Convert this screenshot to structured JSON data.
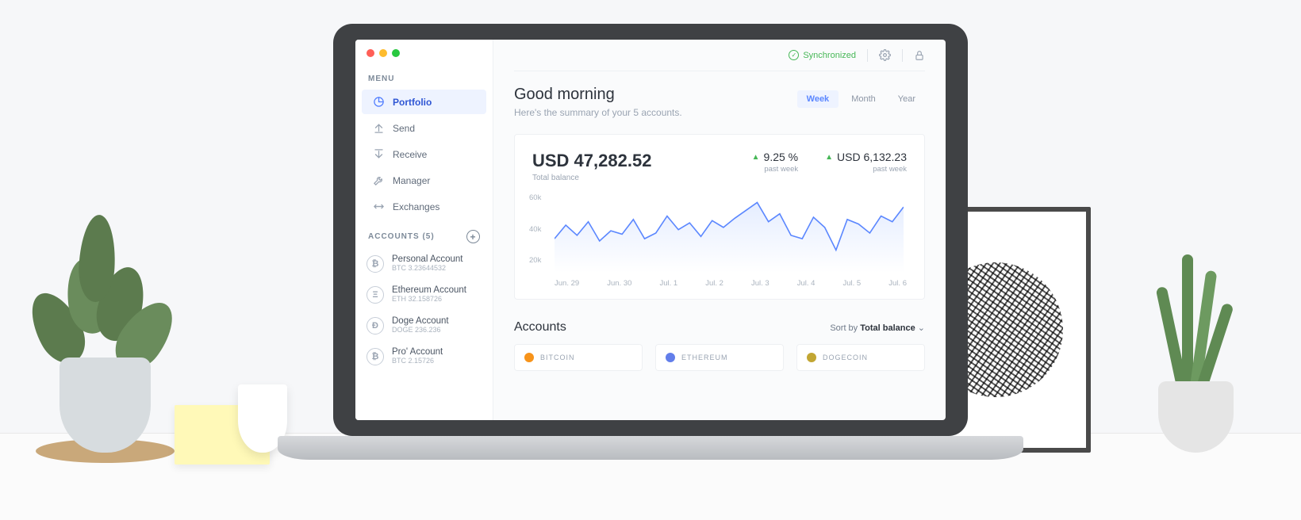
{
  "sidebar": {
    "menu_hdr": "MENU",
    "items": [
      {
        "label": "Portfolio",
        "icon": "pie-chart-icon",
        "active": true
      },
      {
        "label": "Send",
        "icon": "send-up-icon",
        "active": false
      },
      {
        "label": "Receive",
        "icon": "receive-down-icon",
        "active": false
      },
      {
        "label": "Manager",
        "icon": "wrench-icon",
        "active": false
      },
      {
        "label": "Exchanges",
        "icon": "swap-icon",
        "active": false
      }
    ],
    "accounts_hdr": "ACCOUNTS (5)",
    "accounts": [
      {
        "name": "Personal Account",
        "sub": "BTC 3.23644532",
        "sym": "₿"
      },
      {
        "name": "Ethereum Account",
        "sub": "ETH 32.158726",
        "sym": "Ξ"
      },
      {
        "name": "Doge Account",
        "sub": "DOGE 236.236",
        "sym": "Ð"
      },
      {
        "name": "Pro' Account",
        "sub": "BTC 2.15726",
        "sym": "₿"
      }
    ]
  },
  "header": {
    "sync": "Synchronized"
  },
  "greeting": {
    "title": "Good morning",
    "subtitle": "Here's the summary of your 5 accounts."
  },
  "range": {
    "week": "Week",
    "month": "Month",
    "year": "Year",
    "selected": "week"
  },
  "balance": {
    "total_label": "Total balance",
    "total": "USD 47,282.52",
    "change_pct": "9.25 %",
    "change_pct_label": "past week",
    "change_abs": "USD 6,132.23",
    "change_abs_label": "past week"
  },
  "chart_data": {
    "type": "line",
    "title": "Total balance past week",
    "xlabel": "",
    "ylabel": "",
    "ylim": [
      0,
      70000
    ],
    "y_ticks": [
      "60k",
      "40k",
      "20k"
    ],
    "x_ticks": [
      "Jun. 29",
      "Jun. 30",
      "Jul. 1",
      "Jul. 2",
      "Jul. 3",
      "Jul. 4",
      "Jul. 5",
      "Jul. 6"
    ],
    "x": [
      0,
      1,
      2,
      3,
      4,
      5,
      6,
      7,
      8,
      9,
      10,
      11,
      12,
      13,
      14,
      15,
      16,
      17,
      18,
      19,
      20,
      21,
      22,
      23,
      24,
      25,
      26,
      27,
      28,
      29,
      30,
      31
    ],
    "values": [
      30000,
      42000,
      33000,
      45000,
      28000,
      37000,
      34000,
      47000,
      30000,
      35000,
      50000,
      38000,
      44000,
      32000,
      46000,
      40000,
      48000,
      55000,
      62000,
      45000,
      52000,
      33000,
      30000,
      49000,
      40000,
      20000,
      47000,
      43000,
      35000,
      50000,
      45000,
      58000
    ]
  },
  "accounts_section": {
    "title": "Accounts",
    "sort_prefix": "Sort by ",
    "sort_value": "Total balance",
    "cards": [
      {
        "coin": "BITCOIN",
        "color": "#f7931a"
      },
      {
        "coin": "ETHEREUM",
        "color": "#627eea"
      },
      {
        "coin": "DOGECOIN",
        "color": "#c2a633"
      }
    ]
  }
}
